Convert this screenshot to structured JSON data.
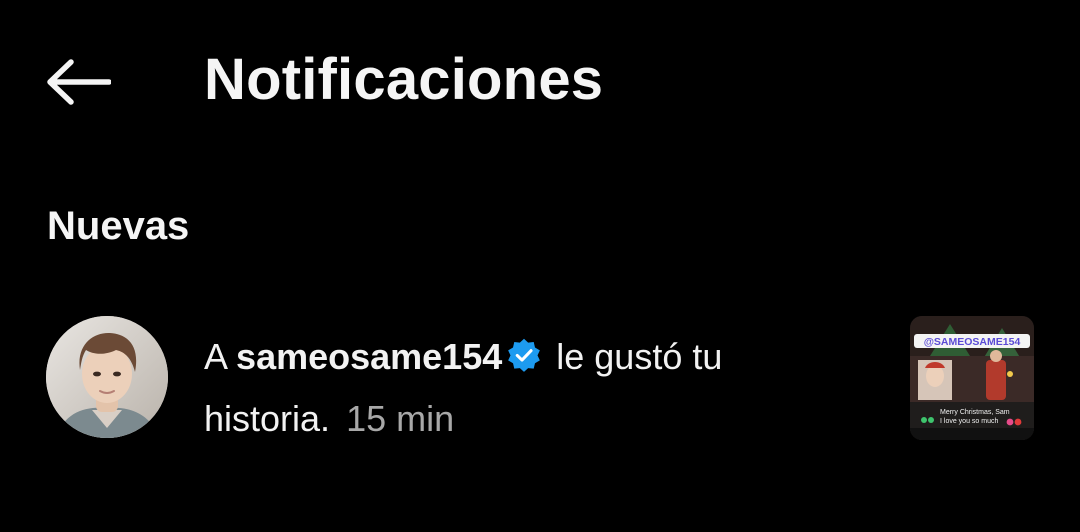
{
  "header": {
    "back_icon": "arrow-left-icon",
    "title": "Notificaciones"
  },
  "section": {
    "title": "Nuevas"
  },
  "notification": {
    "prefix": "A",
    "username": "sameosame154",
    "verified_icon": "verified-badge-icon",
    "message_line1": "le gustó tu",
    "message_line2": "historia.",
    "time": "15 min",
    "thumbnail": {
      "mention": "@SAMEOSAME154",
      "caption_line1": "Merry Christmas, Sam",
      "caption_line2": "I love you so much"
    }
  },
  "colors": {
    "background": "#000000",
    "text": "#f5f5f5",
    "muted": "#a8a8a8",
    "verified": "#1d9bf0"
  }
}
